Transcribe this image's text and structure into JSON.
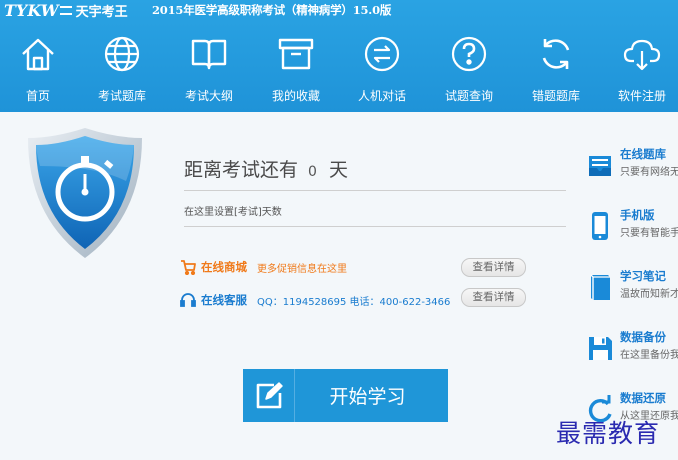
{
  "app": {
    "logo_text": "TYKW",
    "brand_name": "天宇考王",
    "title": "2015年医学高级职称考试（精神病学）15.0版"
  },
  "nav": [
    {
      "label": "首页",
      "icon": "home-icon"
    },
    {
      "label": "考试题库",
      "icon": "globe-icon"
    },
    {
      "label": "考试大纲",
      "icon": "book-icon"
    },
    {
      "label": "我的收藏",
      "icon": "archive-box-icon"
    },
    {
      "label": "人机对话",
      "icon": "exchange-icon"
    },
    {
      "label": "试题查询",
      "icon": "help-icon"
    },
    {
      "label": "错题题库",
      "icon": "refresh-icon"
    },
    {
      "label": "软件注册",
      "icon": "cloud-download-icon"
    }
  ],
  "countdown": {
    "prefix": "距离考试还有",
    "days": "0",
    "unit": "天",
    "set_link": "在这里设置[考试]天数"
  },
  "shop": {
    "title": "在线商城",
    "desc": "更多促销信息在这里",
    "button": "查看详情"
  },
  "service": {
    "title": "在线客服",
    "desc": "QQ：1194528695 电话：400-622-3466",
    "button": "查看详情"
  },
  "start_button": {
    "label": "开始学习"
  },
  "side": [
    {
      "title": "在线题库",
      "desc": "只要有网络无论",
      "icon": "online-bank-icon"
    },
    {
      "title": "手机版",
      "desc": "只要有智能手机",
      "icon": "mobile-icon"
    },
    {
      "title": "学习笔记",
      "desc": "温故而知新才",
      "icon": "notebook-icon"
    },
    {
      "title": "数据备份",
      "desc": "在这里备份我的",
      "icon": "save-disk-icon"
    },
    {
      "title": "数据还原",
      "desc": "从这里还原我的",
      "icon": "restore-icon"
    }
  ],
  "watermark": "最需教育",
  "colors": {
    "header": "#1f93d8",
    "accent_orange": "#f07a1a",
    "link_blue": "#1a7ccf",
    "start_button": "#1f96d8"
  }
}
